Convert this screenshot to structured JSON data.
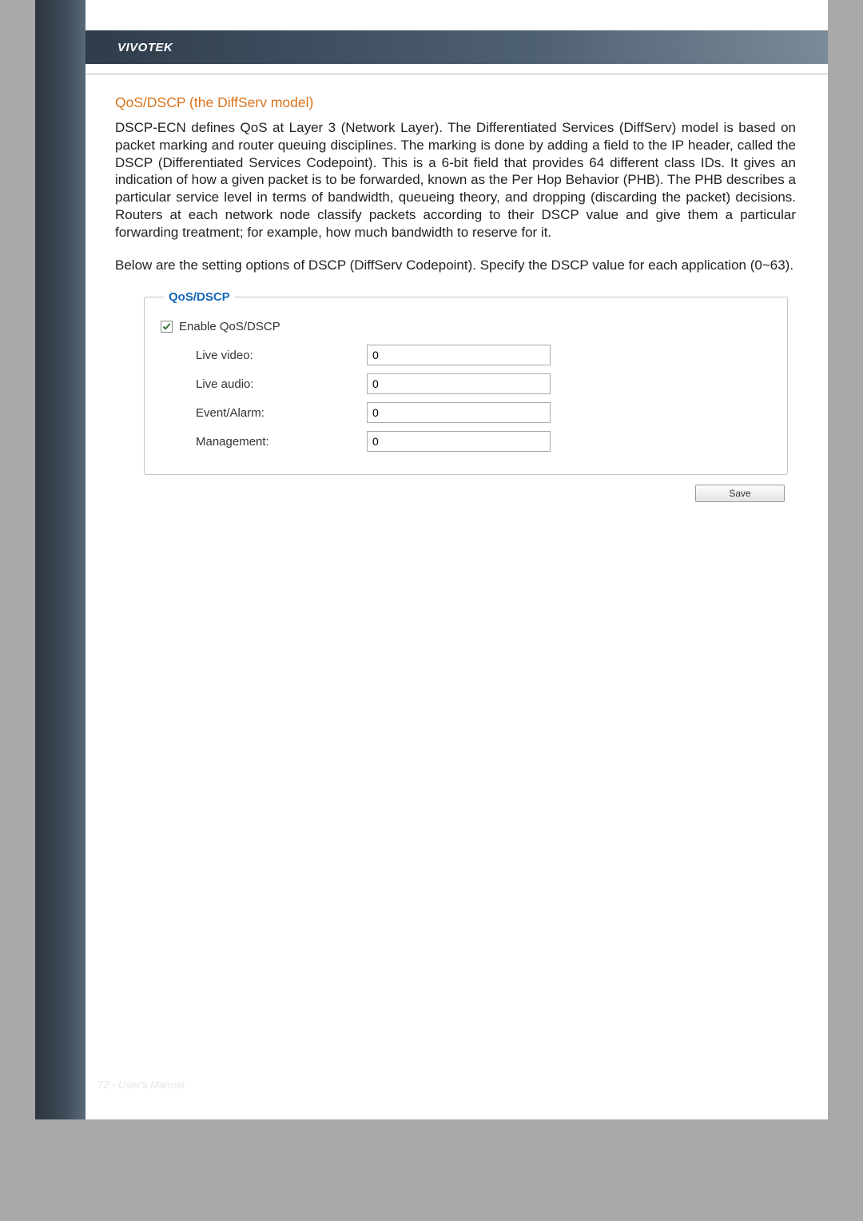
{
  "header": {
    "brand": "VIVOTEK"
  },
  "section": {
    "title": "QoS/DSCP (the DiffServ model)",
    "para1": "DSCP-ECN defines QoS at Layer 3 (Network Layer). The Differentiated Services (DiffServ) model is based on packet marking and router queuing disciplines. The marking is done by adding a field to the IP header, called the DSCP (Differentiated Services Codepoint). This is a 6-bit field that provides 64 different class IDs. It gives an indication of how a given packet is to be forwarded, known as the Per Hop Behavior (PHB). The PHB describes a particular service level in terms of bandwidth, queueing theory, and dropping (discarding the packet) decisions. Routers at each network node classify packets according to their DSCP value and give them a particular forwarding treatment; for example, how much bandwidth to reserve for it.",
    "para2": "Below are the setting options of DSCP (DiffServ Codepoint). Specify the DSCP value for each application (0~63)."
  },
  "panel": {
    "legend": "QoS/DSCP",
    "enable_label": "Enable QoS/DSCP",
    "enable_checked": true,
    "fields": {
      "live_video_label": "Live video:",
      "live_video_value": "0",
      "live_audio_label": "Live audio:",
      "live_audio_value": "0",
      "event_alarm_label": "Event/Alarm:",
      "event_alarm_value": "0",
      "management_label": "Management:",
      "management_value": "0"
    },
    "save_label": "Save"
  },
  "footer": {
    "text": "72 - User's Manual"
  }
}
